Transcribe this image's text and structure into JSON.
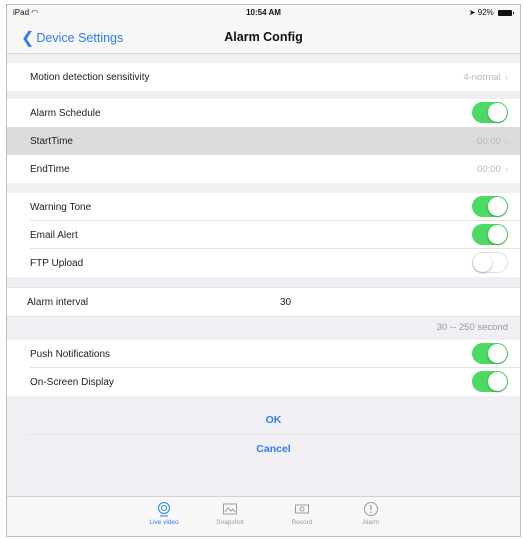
{
  "status_bar": {
    "device": "iPad",
    "time": "10:54 AM",
    "battery": "92%"
  },
  "nav": {
    "back_label": "Device Settings",
    "title": "Alarm Config"
  },
  "motion": {
    "label": "Motion detection sensitivity",
    "value": "4-normal"
  },
  "schedule": {
    "label": "Alarm Schedule",
    "enabled": true,
    "start_label": "StartTime",
    "start_value": "00:00",
    "end_label": "EndTime",
    "end_value": "00:00"
  },
  "alerts": {
    "warning_tone": {
      "label": "Warning Tone",
      "enabled": true
    },
    "email_alert": {
      "label": "Email Alert",
      "enabled": true
    },
    "ftp_upload": {
      "label": "FTP Upload",
      "enabled": false
    }
  },
  "interval": {
    "label": "Alarm interval",
    "value": "30",
    "range_hint": "30 -- 250 second"
  },
  "notifications": {
    "push": {
      "label": "Push Notifications",
      "enabled": true
    },
    "osd": {
      "label": "On-Screen Display",
      "enabled": true
    }
  },
  "actions": {
    "ok_label": "OK",
    "cancel_label": "Cancel"
  },
  "tabs": [
    {
      "label": "Live video",
      "icon": "live-video-icon",
      "active": true
    },
    {
      "label": "Snapshot",
      "icon": "snapshot-icon",
      "active": false
    },
    {
      "label": "Record",
      "icon": "record-icon",
      "active": false
    },
    {
      "label": "Alarm",
      "icon": "alarm-icon",
      "active": false
    }
  ],
  "colors": {
    "accent": "#2f7cf6",
    "toggle_on": "#4cd964",
    "background": "#efeff4"
  }
}
